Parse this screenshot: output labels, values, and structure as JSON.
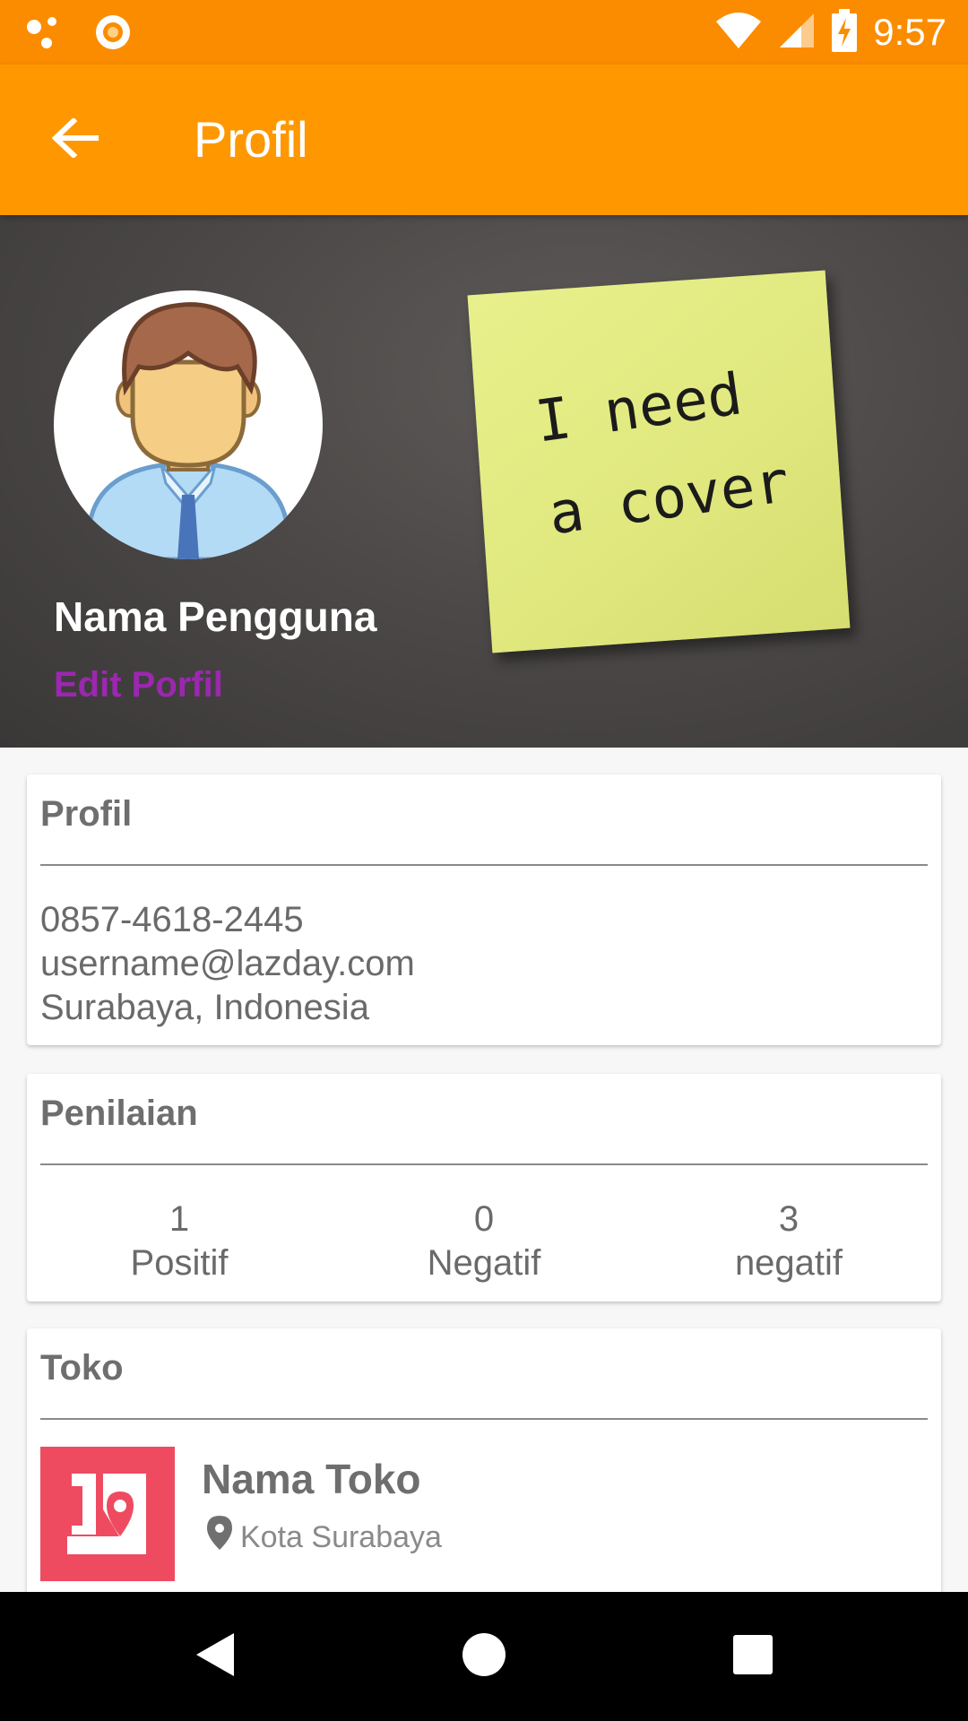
{
  "status_bar": {
    "time": "9:57",
    "icons": [
      "notification-dots-icon",
      "record-icon",
      "wifi-icon",
      "cell-signal-icon",
      "battery-charging-icon"
    ]
  },
  "app_bar": {
    "title": "Profil",
    "back_icon": "arrow-left-icon"
  },
  "cover": {
    "user_name": "Nama Pengguna",
    "edit_label": "Edit Porfil",
    "sticky_note_text": "I need\na cover"
  },
  "profile": {
    "title": "Profil",
    "phone": "0857-4618-2445",
    "email": "username@lazday.com",
    "location": "Surabaya, Indonesia"
  },
  "rating": {
    "title": "Penilaian",
    "items": [
      {
        "count": "1",
        "label": "Positif"
      },
      {
        "count": "0",
        "label": "Negatif"
      },
      {
        "count": "3",
        "label": "negatif"
      }
    ]
  },
  "store": {
    "title": "Toko",
    "name": "Nama Toko",
    "city": "Kota Surabaya"
  },
  "colors": {
    "status_bar": "#fb8c00",
    "app_bar": "#ff9800",
    "accent": "#9c27b0",
    "store_logo": "#ee4b61"
  }
}
